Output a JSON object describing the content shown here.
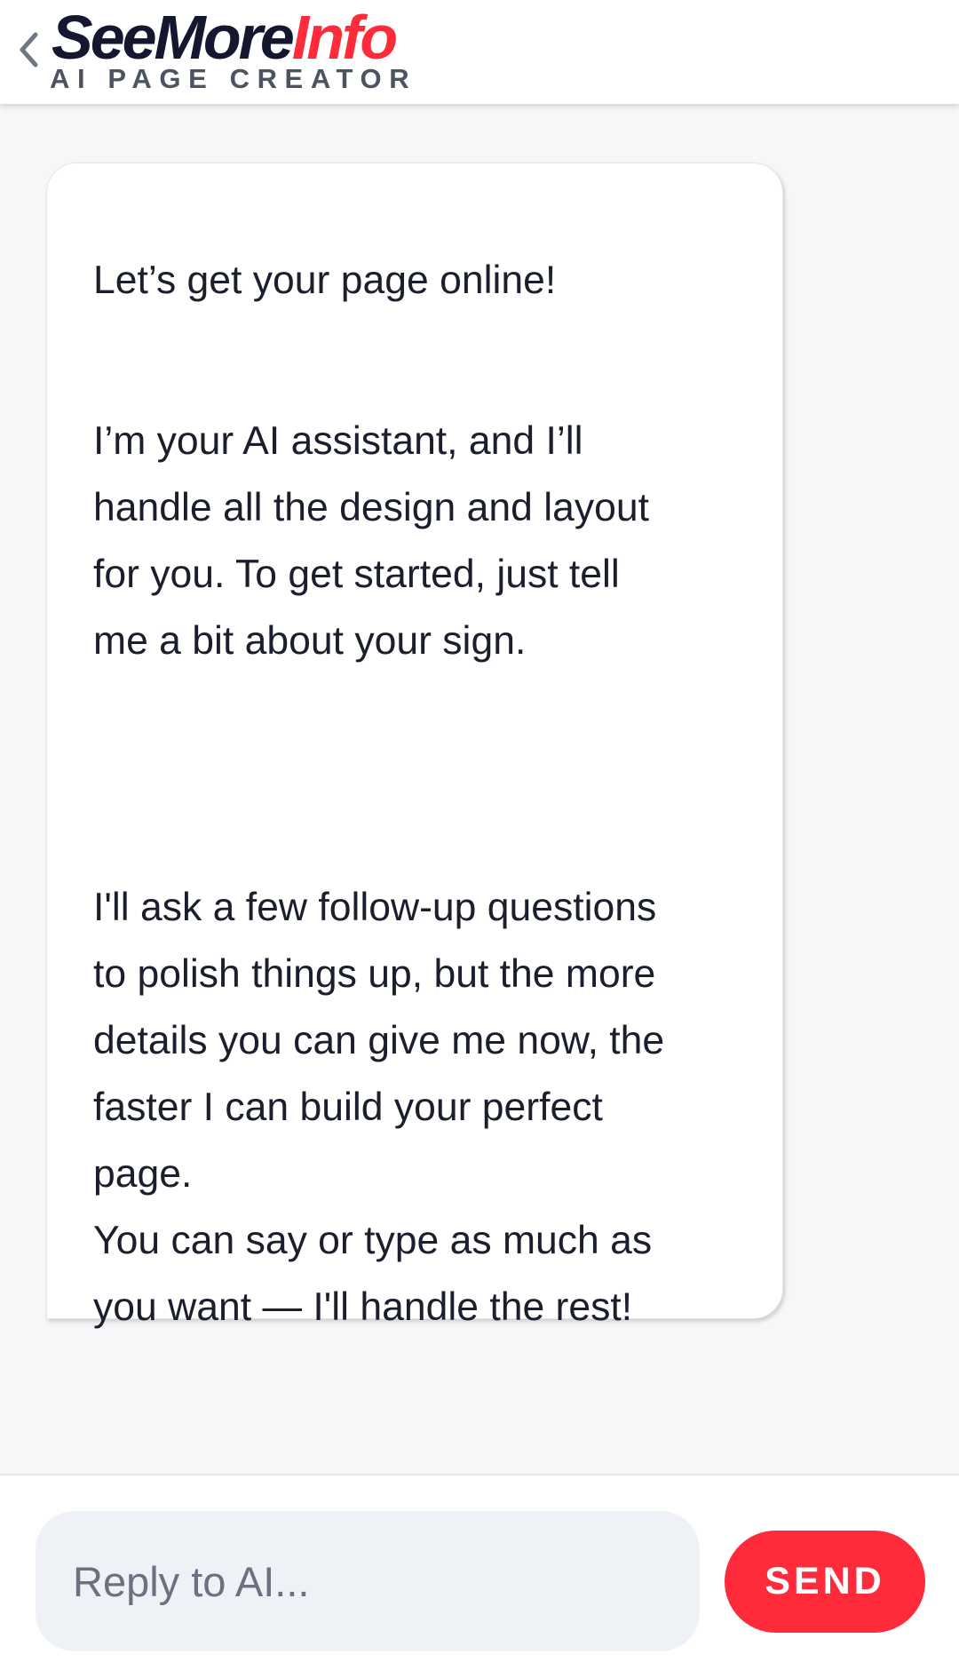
{
  "header": {
    "back_icon": "chevron-left-icon",
    "logo": {
      "part1": "SeeMore",
      "part2": "Info",
      "tagline": "AI PAGE CREATOR"
    }
  },
  "chat": {
    "message": {
      "p1": "Let’s get your page online!",
      "p2": "I’m your AI assistant, and I’ll\nhandle all the design and layout\nfor you. To get started, just tell\nme a bit about your sign.",
      "p3": "I'll ask a few follow-up questions\nto polish things up, but the more\ndetails you can give me now, the\nfaster I can build your perfect\npage.",
      "p4": "You can say or type as much as\nyou want — I'll handle the rest!"
    }
  },
  "composer": {
    "placeholder": "Reply to AI...",
    "value": "",
    "send_label": "SEND"
  },
  "colors": {
    "brand_red": "#ff2a3a",
    "brand_dark": "#14172f",
    "background": "#f6f7f9",
    "input_bg": "#eef1f6"
  }
}
